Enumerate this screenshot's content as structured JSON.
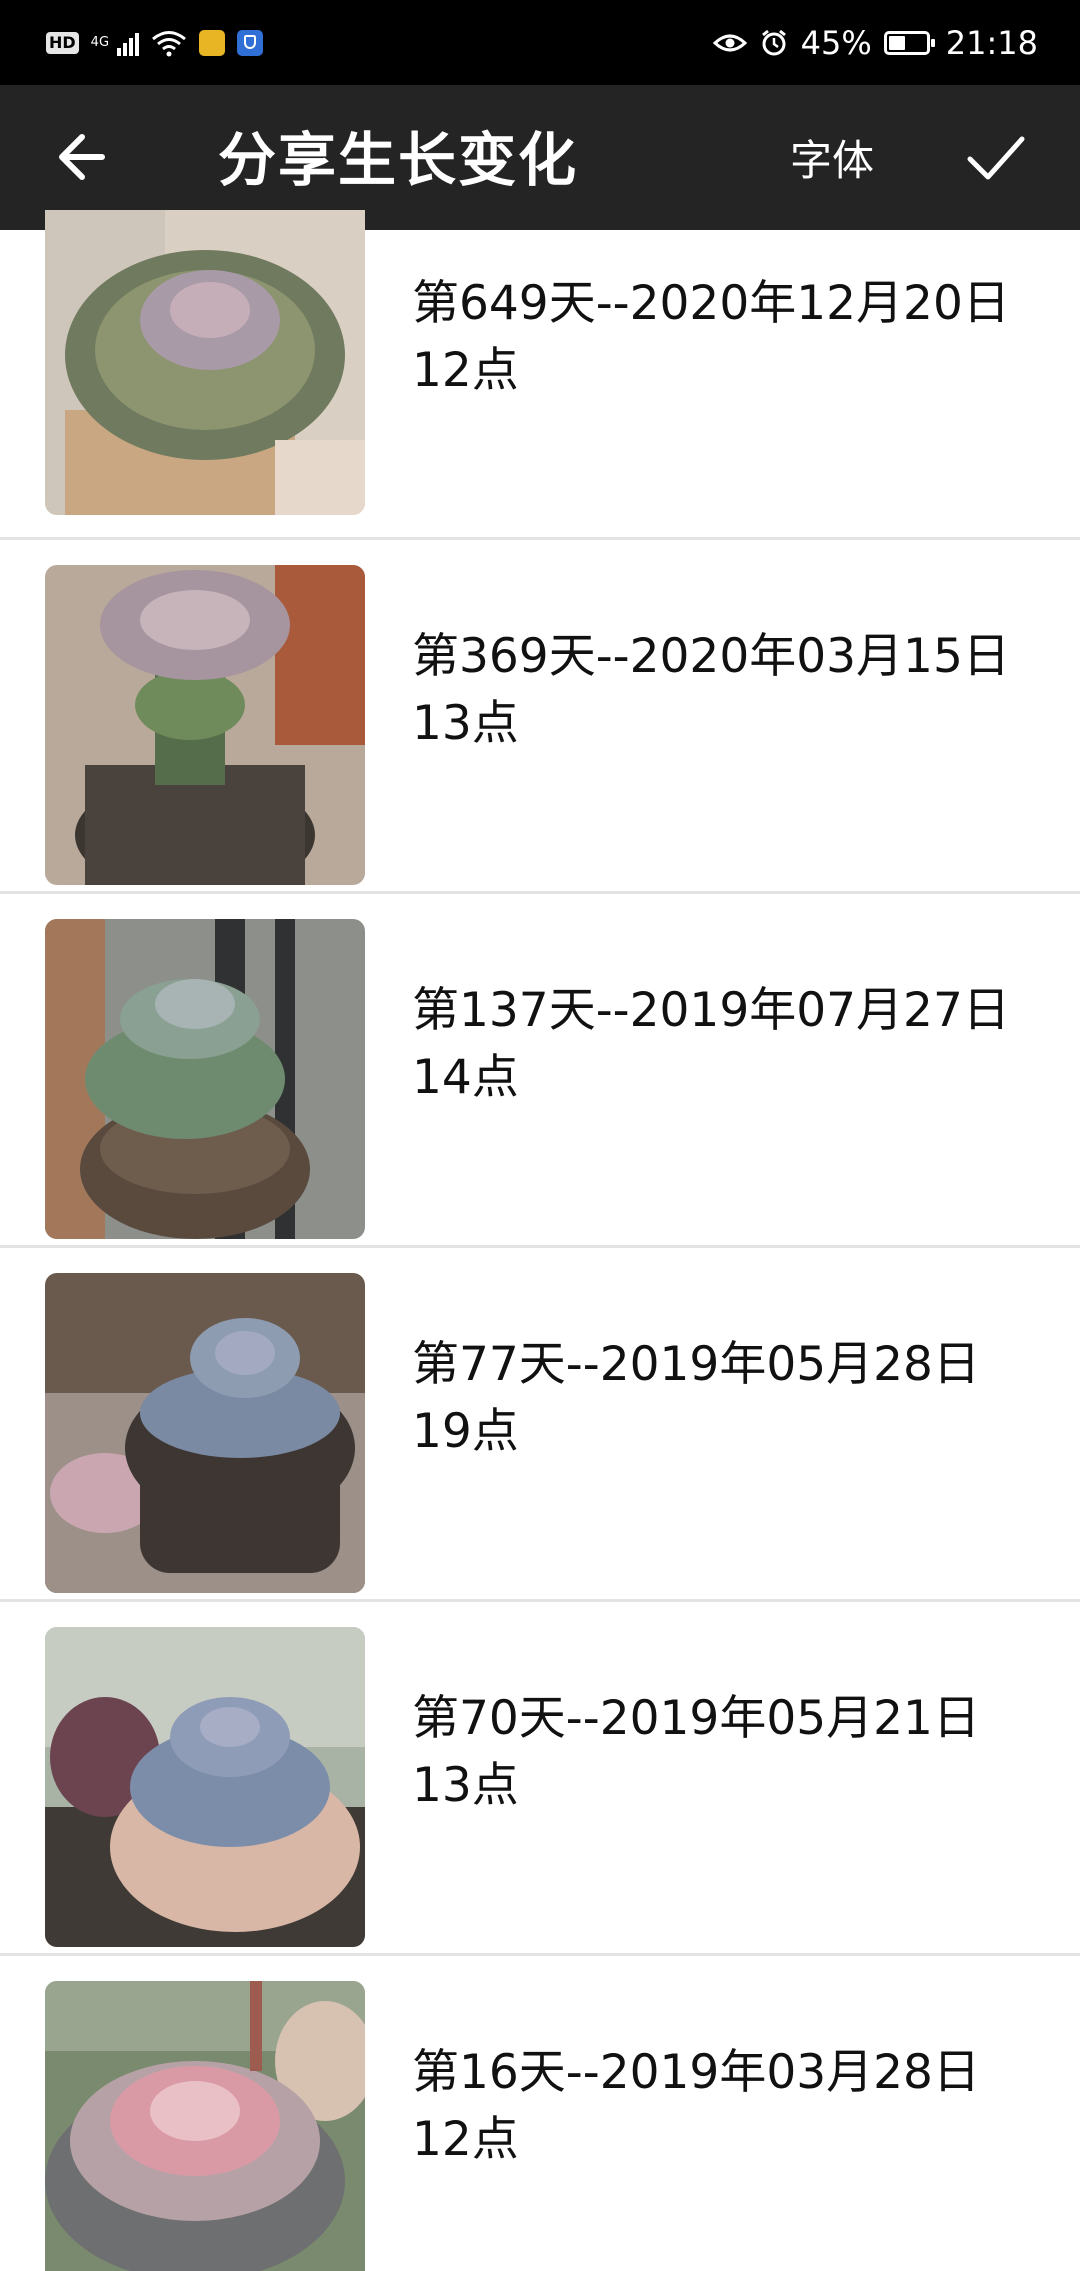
{
  "status_bar": {
    "hd_label": "HD",
    "network_label": "4G",
    "battery_percent": "45%",
    "battery_level": 0.45,
    "time": "21:18",
    "icons": [
      "hd-icon",
      "signal-icon",
      "wifi-icon",
      "app-notification-icon",
      "shield-app-icon",
      "eye-icon",
      "alarm-icon",
      "battery-icon"
    ]
  },
  "app_bar": {
    "title": "分享生长变化",
    "font_button": "字体",
    "icons": [
      "back-arrow-icon",
      "checkmark-icon"
    ]
  },
  "records": [
    {
      "line1": "第649天--2020年12月20日",
      "line2": "12点",
      "thumbnail_icon": "succulent-photo"
    },
    {
      "line1": "第369天--2020年03月15日",
      "line2": "13点",
      "thumbnail_icon": "succulent-photo"
    },
    {
      "line1": "第137天--2019年07月27日",
      "line2": "14点",
      "thumbnail_icon": "succulent-photo"
    },
    {
      "line1": "第77天--2019年05月28日",
      "line2": "19点",
      "thumbnail_icon": "succulent-photo"
    },
    {
      "line1": "第70天--2019年05月21日",
      "line2": "13点",
      "thumbnail_icon": "succulent-photo"
    },
    {
      "line1": "第16天--2019年03月28日",
      "line2": "12点",
      "thumbnail_icon": "succulent-photo"
    }
  ],
  "colors": {
    "status_bar_bg": "#000000",
    "app_bar_bg": "#242424",
    "divider": "#e3e3e3"
  }
}
